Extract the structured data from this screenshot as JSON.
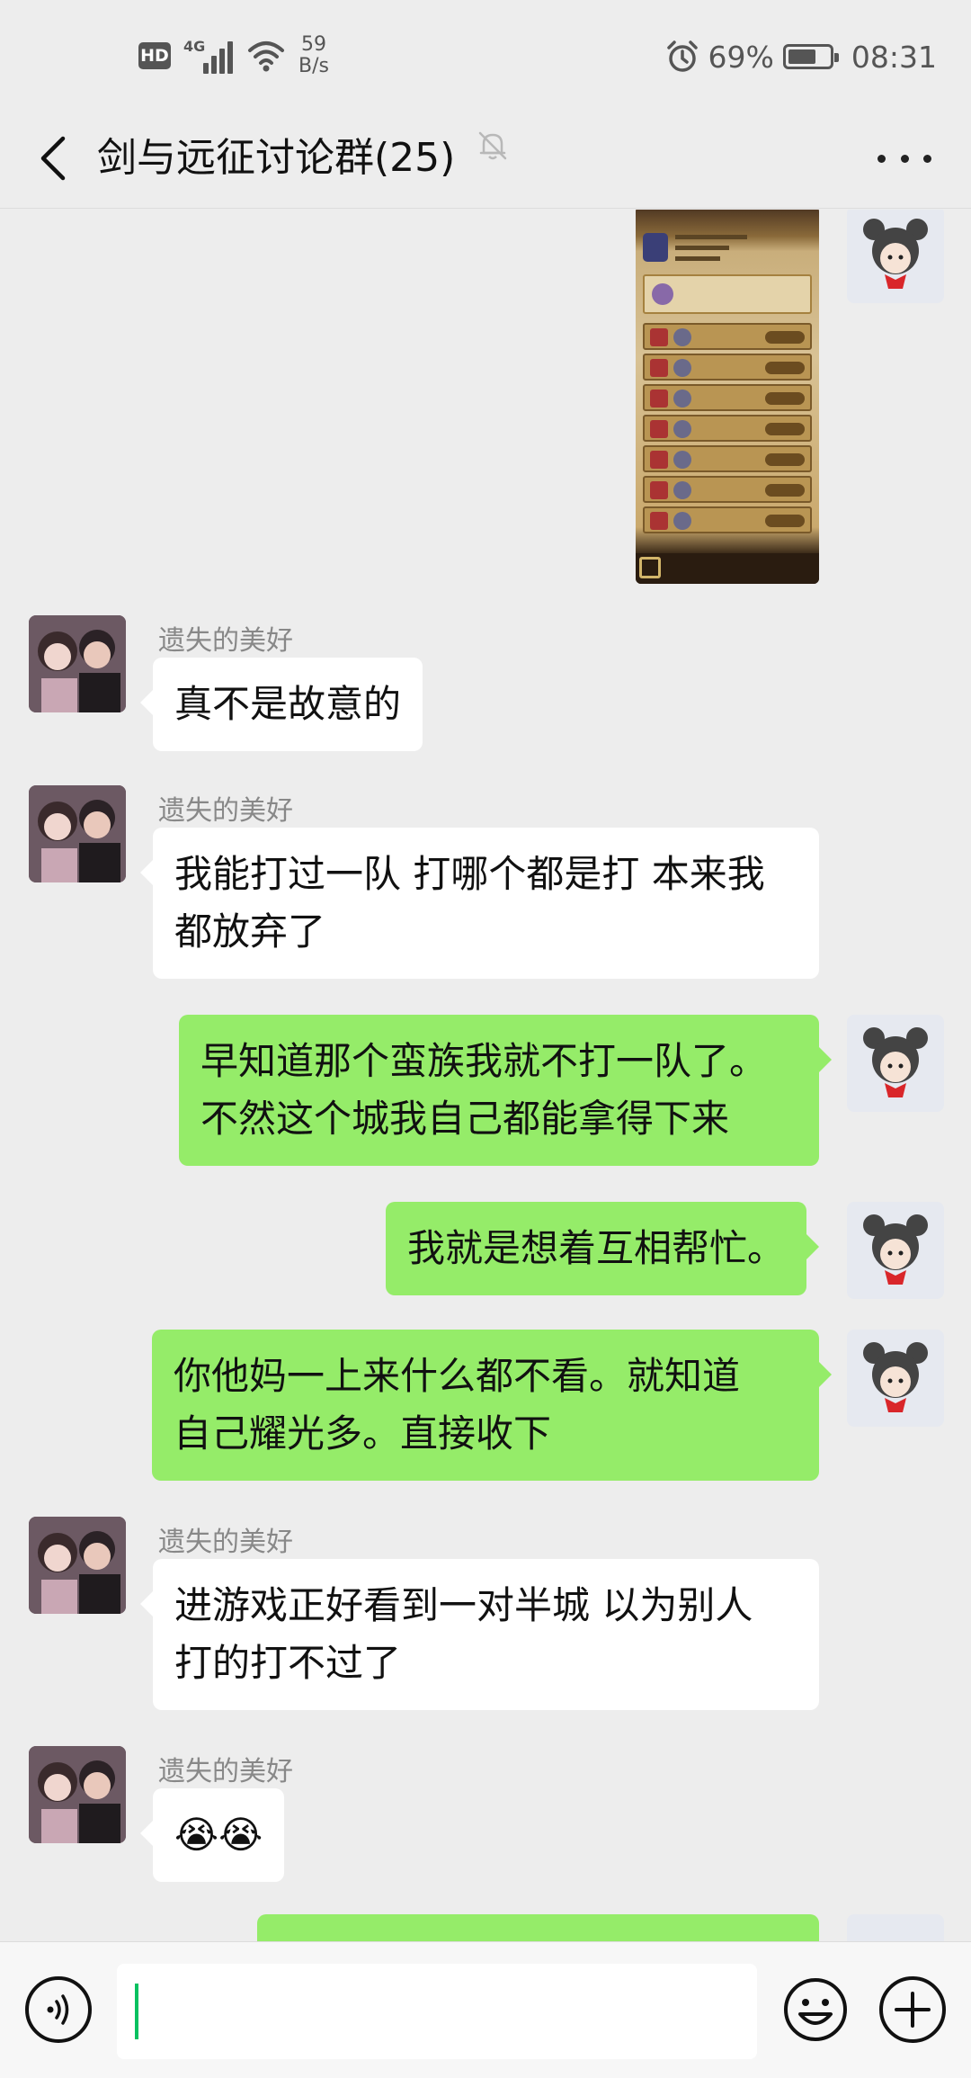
{
  "status_bar": {
    "hd_label": "HD",
    "network_label": "4G",
    "speed_value": "59",
    "speed_unit": "B/s",
    "battery_percent": "69%",
    "battery_level": 0.69,
    "time": "08:31"
  },
  "header": {
    "title": "剑与远征讨论群(25)"
  },
  "messages": [
    {
      "from": "self",
      "kind": "image"
    },
    {
      "from": "other",
      "sender": "遗失的美好",
      "lines": [
        "真不是故意的"
      ]
    },
    {
      "from": "other",
      "sender": "遗失的美好",
      "lines": [
        "我能打过一队 打哪个都是打 本来我",
        "都放弃了"
      ]
    },
    {
      "from": "self",
      "lines": [
        "早知道那个蛮族我就不打一队了。",
        "不然这个城我自己都能拿得下来"
      ]
    },
    {
      "from": "self",
      "lines": [
        "我就是想着互相帮忙。"
      ]
    },
    {
      "from": "self",
      "lines": [
        "你他妈一上来什么都不看。就知道",
        "自己耀光多。直接收下"
      ]
    },
    {
      "from": "other",
      "sender": "遗失的美好",
      "lines": [
        "进游戏正好看到一对半城 以为别人",
        "打的打不过了"
      ]
    },
    {
      "from": "other",
      "sender": "遗失的美好",
      "lines": [
        "😭😭"
      ]
    }
  ],
  "colors": {
    "background": "#ededed",
    "self_bubble": "#95ec69",
    "other_bubble": "#ffffff",
    "cursor": "#07c160"
  },
  "icons": {
    "back": "back-arrow-icon",
    "mute": "bell-muted-icon",
    "more": "more-dots-icon",
    "voice": "voice-icon",
    "emoji": "emoji-icon",
    "plus": "plus-icon"
  }
}
